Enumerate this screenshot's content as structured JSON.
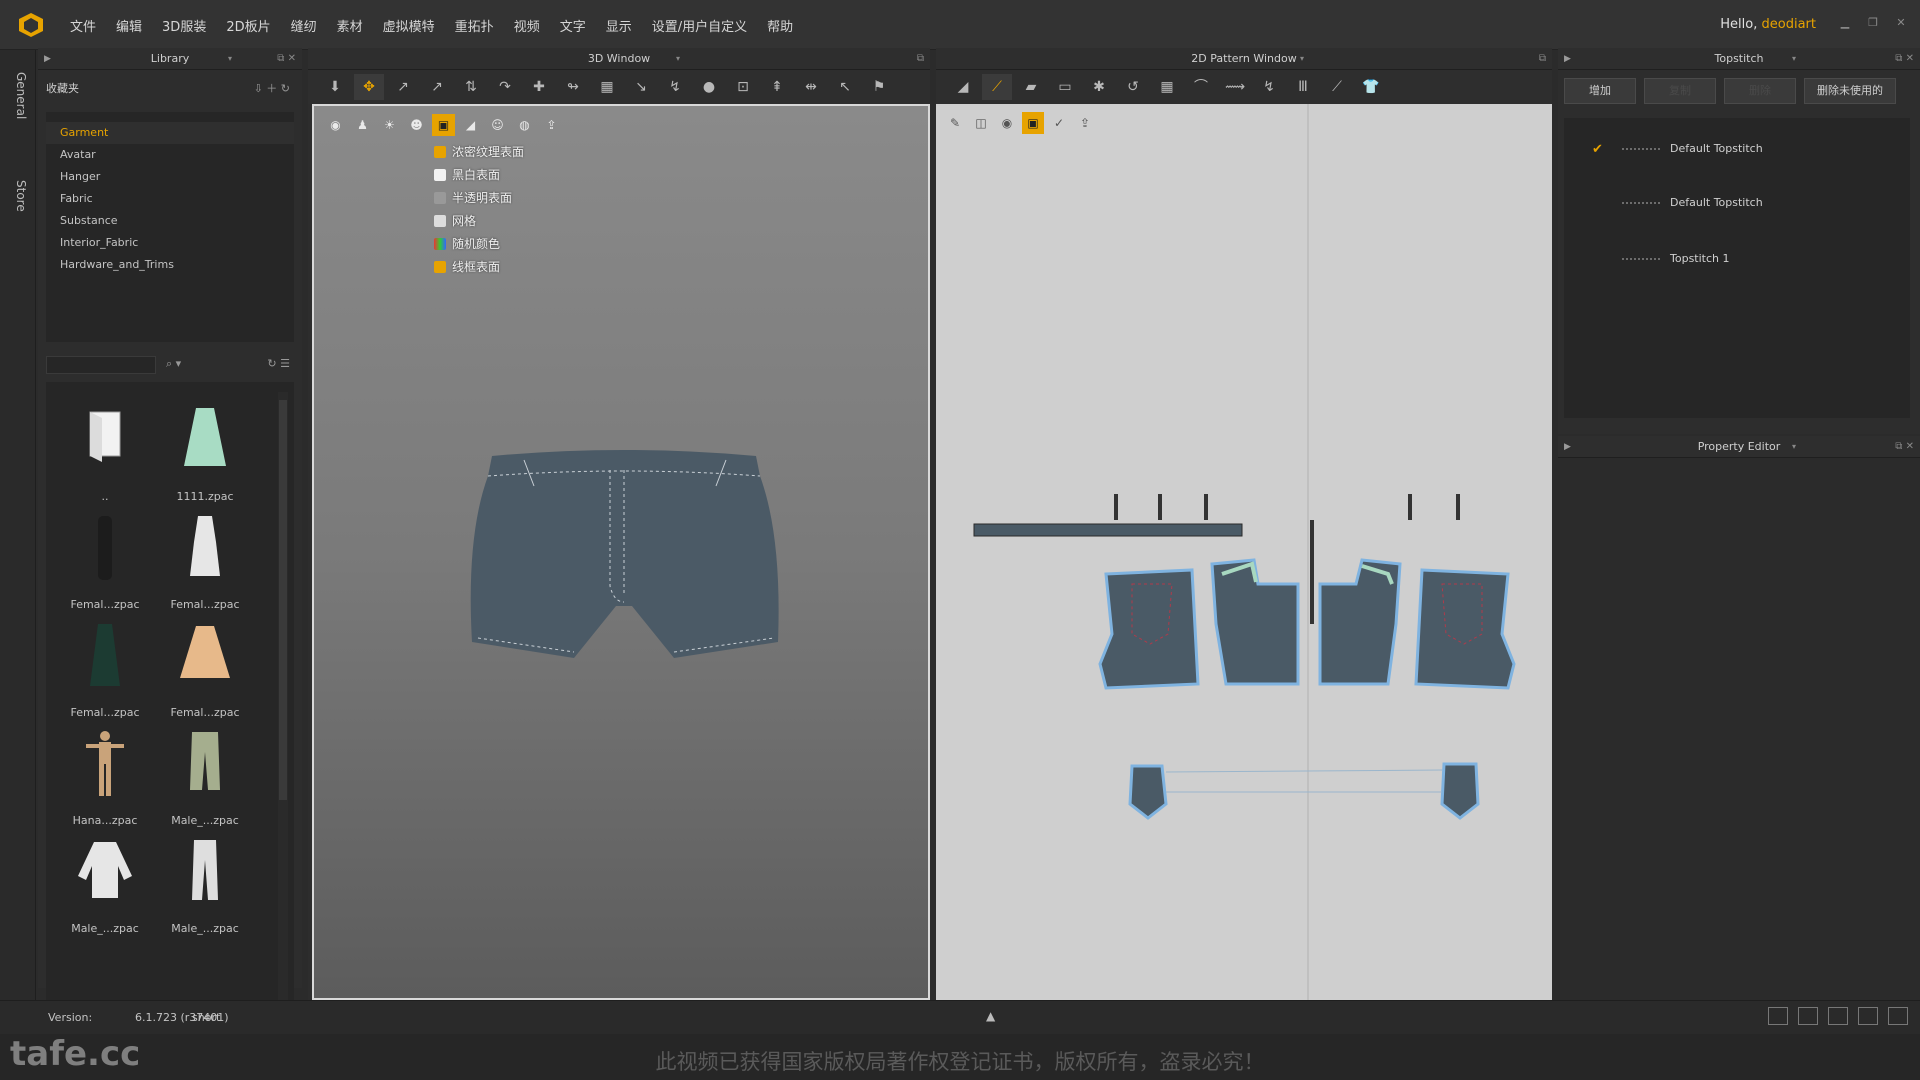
{
  "app": {
    "menu": [
      "文件",
      "编辑",
      "3D服装",
      "2D板片",
      "缝纫",
      "素材",
      "虚拟模特",
      "重拓扑",
      "视频",
      "文字",
      "显示",
      "设置/用户自定义",
      "帮助"
    ],
    "greeting": "Hello,",
    "username": "deodiart"
  },
  "sidetabs": [
    "General",
    "Store"
  ],
  "library": {
    "title": "Library",
    "favorites": "收藏夹",
    "tree": [
      "Garment",
      "Avatar",
      "Hanger",
      "Fabric",
      "Substance",
      "Interior_Fabric",
      "Hardware_and_Trims"
    ],
    "items": [
      {
        "label": ".."
      },
      {
        "label": "1111.zpac"
      },
      {
        "label": "Femal...zpac"
      },
      {
        "label": "Femal...zpac"
      },
      {
        "label": "Femal...zpac"
      },
      {
        "label": "Femal...zpac"
      },
      {
        "label": "Hana...zpac"
      },
      {
        "label": "Male_...zpac"
      },
      {
        "label": "Male_...zpac"
      },
      {
        "label": "Male_...zpac"
      }
    ]
  },
  "window3d": {
    "title": "3D Window",
    "texture_menu": [
      "浓密纹理表面",
      "黑白表面",
      "半透明表面",
      "网格",
      "随机颜色",
      "线框表面"
    ]
  },
  "window2d": {
    "title": "2D Pattern Window"
  },
  "topstitch": {
    "title": "Topstitch",
    "buttons": [
      "增加",
      "复制",
      "删除",
      "删除未使用的"
    ],
    "rows": [
      {
        "label": "Default Topstitch",
        "checked": true
      },
      {
        "label": "Default Topstitch",
        "checked": false
      },
      {
        "label": "Topstitch 1",
        "checked": false
      }
    ]
  },
  "property_editor": {
    "title": "Property Editor"
  },
  "status": {
    "version_label": "Version:",
    "version": "6.1.723 (r37401)",
    "mode": "short"
  },
  "watermark": {
    "logo": "tafe.cc",
    "notice": "此视频已获得国家版权局著作权登记证书，版权所有，盗录必究！"
  },
  "colors": {
    "accent": "#e7a300",
    "denim": "#4a5a66",
    "pattern_outline": "#7fb3e0"
  }
}
